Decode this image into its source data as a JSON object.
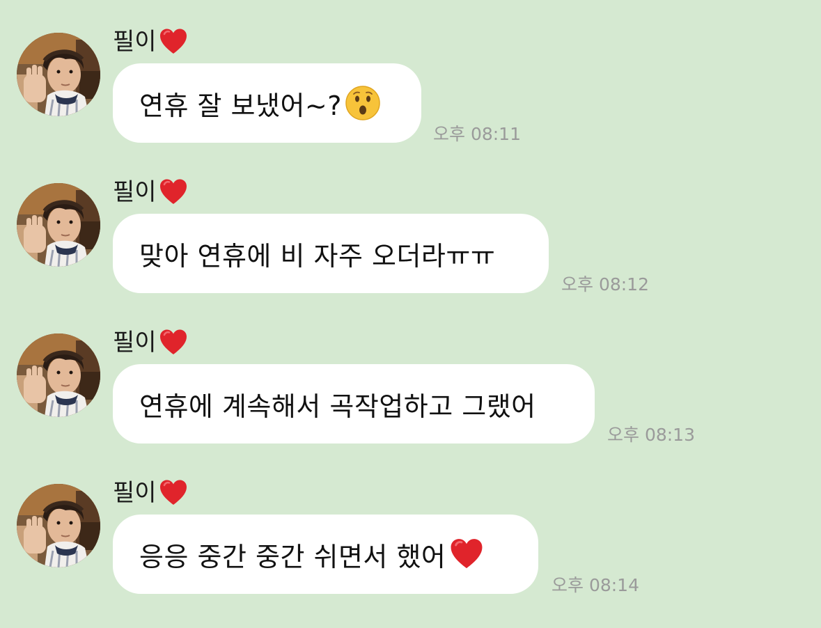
{
  "colors": {
    "background": "#d5e9d1",
    "bubble": "#ffffff",
    "timestamp": "#9a9a9a",
    "heart": "#e0242b"
  },
  "messages": [
    {
      "sender": "필이",
      "sender_icon": "red-heart-icon",
      "text": "연휴 잘 보냈어~?",
      "trailing_icon": "hushed-face-emoji",
      "time": "오후 08:11"
    },
    {
      "sender": "필이",
      "sender_icon": "red-heart-icon",
      "text": "맞아 연휴에 비 자주 오더라ㅠㅠ",
      "trailing_icon": "",
      "time": "오후 08:12"
    },
    {
      "sender": "필이",
      "sender_icon": "red-heart-icon",
      "text": "연휴에 계속해서 곡작업하고 그랬어",
      "trailing_icon": "",
      "time": "오후 08:13"
    },
    {
      "sender": "필이",
      "sender_icon": "red-heart-icon",
      "text": "응응 중간 중간 쉬면서 했어",
      "trailing_icon": "red-heart-icon",
      "time": "오후 08:14"
    }
  ]
}
